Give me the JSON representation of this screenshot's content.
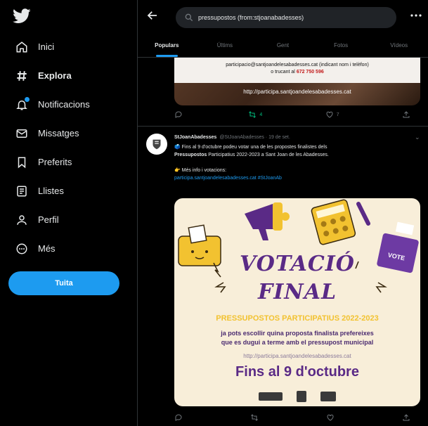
{
  "sidebar": {
    "items": [
      {
        "label": "Inici",
        "icon": "home-icon"
      },
      {
        "label": "Explora",
        "icon": "hashtag-icon"
      },
      {
        "label": "Notificacions",
        "icon": "bell-icon"
      },
      {
        "label": "Missatges",
        "icon": "mail-icon"
      },
      {
        "label": "Preferits",
        "icon": "bookmark-icon"
      },
      {
        "label": "Llistes",
        "icon": "list-icon"
      },
      {
        "label": "Perfil",
        "icon": "person-icon"
      },
      {
        "label": "Més",
        "icon": "more-circle-icon"
      }
    ],
    "tweet_button": "Tuita"
  },
  "search": {
    "query": "pressupostos (from:stjoanabadesses)"
  },
  "tabs": [
    "Populars",
    "Últims",
    "Gent",
    "Fotos",
    "Vídeos"
  ],
  "prev_tweet": {
    "card_line1": "participacio@santjoandelesabadesses.cat (indicant nom i telèfon)",
    "card_line2_prefix": "o trucant al ",
    "card_phone": "672 750 596",
    "url": "http://participa.santjoandelesabadesses.cat",
    "retweets": "4",
    "likes": "7"
  },
  "tweet": {
    "name": "StJoanAbadesses",
    "handle": "@StJoanAbadesses · 19 de set.",
    "line1": "🗳️ Fins al 9 d'octubre podeu votar una de les propostes finalistes dels",
    "line2_bold": "Pressupostos",
    "line2_rest": " Participatius 2022-2023 a Sant Joan de les Abadesses.",
    "line3": "👉 Més info i votacions:",
    "link": "participa.santjoandelesabadesses.cat #StJoanAb"
  },
  "poster": {
    "title1": "VOTACIÓ",
    "title2": "FINAL",
    "subtitle": "PRESSUPOSTOS PARTICIPATIUS 2022-2023",
    "desc1": "ja pots escollir quina proposta finalista prefereixes",
    "desc2": "que es dugui a terme amb el pressupost municipal",
    "url": "http://participa.santjoandelesabadesses.cat",
    "deadline": "Fins al 9 d'octubre",
    "vote_box_label": "VOTE"
  }
}
